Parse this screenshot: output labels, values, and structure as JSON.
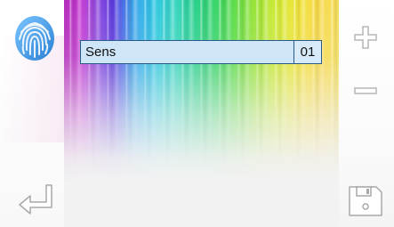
{
  "setting": {
    "label": "Sens",
    "value": "01"
  },
  "icons": {
    "fingerprint": "fingerprint-icon",
    "plus": "plus-icon",
    "minus": "minus-icon",
    "back": "enter-back-arrow-icon",
    "save": "floppy-disk-icon"
  },
  "colors": {
    "accent": "#4aa3e8",
    "row_fill": "#cfe6f8",
    "row_border": "#2a5a8a",
    "icon_gray": "#b5b5b5"
  }
}
